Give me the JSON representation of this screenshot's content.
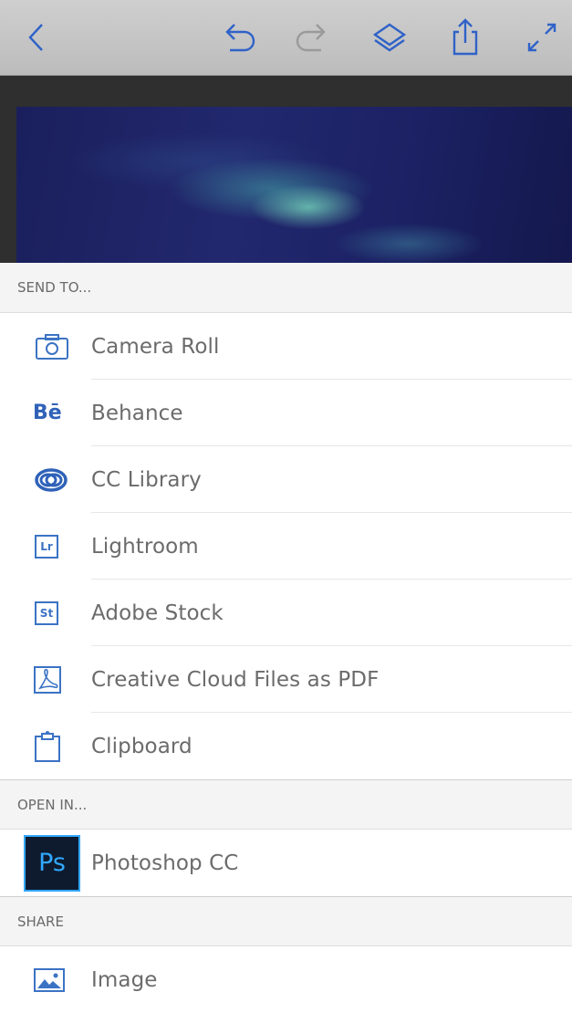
{
  "toolbar": {
    "icons": [
      "back-chevron-icon",
      "undo-icon",
      "redo-icon",
      "layers-icon",
      "share-icon",
      "fullscreen-icon"
    ]
  },
  "send_to": {
    "header": "SEND TO...",
    "items": [
      {
        "label": "Camera Roll",
        "icon": "camera-icon"
      },
      {
        "label": "Behance",
        "icon": "behance-icon",
        "icon_text": "Bē"
      },
      {
        "label": "CC Library",
        "icon": "creative-cloud-icon"
      },
      {
        "label": "Lightroom",
        "icon": "lightroom-icon",
        "icon_text": "Lr"
      },
      {
        "label": "Adobe Stock",
        "icon": "adobe-stock-icon",
        "icon_text": "St"
      },
      {
        "label": "Creative Cloud Files as PDF",
        "icon": "pdf-icon"
      },
      {
        "label": "Clipboard",
        "icon": "clipboard-icon"
      }
    ]
  },
  "open_in": {
    "header": "OPEN IN...",
    "items": [
      {
        "label": "Photoshop CC",
        "icon": "photoshop-icon",
        "icon_text": "Ps"
      }
    ]
  },
  "share": {
    "header": "SHARE",
    "items": [
      {
        "label": "Image",
        "icon": "image-icon"
      }
    ]
  },
  "colors": {
    "accent_blue": "#3b73c4",
    "photoshop_blue": "#31a8ff",
    "toolbar_gray": "#c4c4c4",
    "text_gray": "#6b6b6b"
  }
}
